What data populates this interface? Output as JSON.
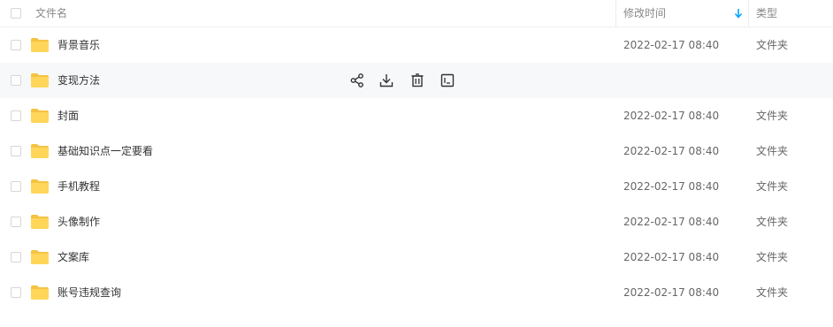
{
  "header": {
    "name_label": "文件名",
    "modified_label": "修改时间",
    "type_label": "类型"
  },
  "colors": {
    "folder": "#FFD659",
    "folder_tab": "#F5C343",
    "sort_arrow": "#06a7ff",
    "hover_row": "#f7f8fa"
  },
  "hover_actions": {
    "icons": [
      "share-icon",
      "download-icon",
      "delete-icon",
      "more-icon"
    ]
  },
  "rows": [
    {
      "name": "背景音乐",
      "date": "2022-02-17 08:40",
      "type": "文件夹"
    },
    {
      "name": "变现方法",
      "date": "",
      "type": ""
    },
    {
      "name": "封面",
      "date": "2022-02-17 08:40",
      "type": "文件夹"
    },
    {
      "name": "基础知识点一定要看",
      "date": "2022-02-17 08:40",
      "type": "文件夹"
    },
    {
      "name": "手机教程",
      "date": "2022-02-17 08:40",
      "type": "文件夹"
    },
    {
      "name": "头像制作",
      "date": "2022-02-17 08:40",
      "type": "文件夹"
    },
    {
      "name": "文案库",
      "date": "2022-02-17 08:40",
      "type": "文件夹"
    },
    {
      "name": "账号违规查询",
      "date": "2022-02-17 08:40",
      "type": "文件夹"
    }
  ]
}
